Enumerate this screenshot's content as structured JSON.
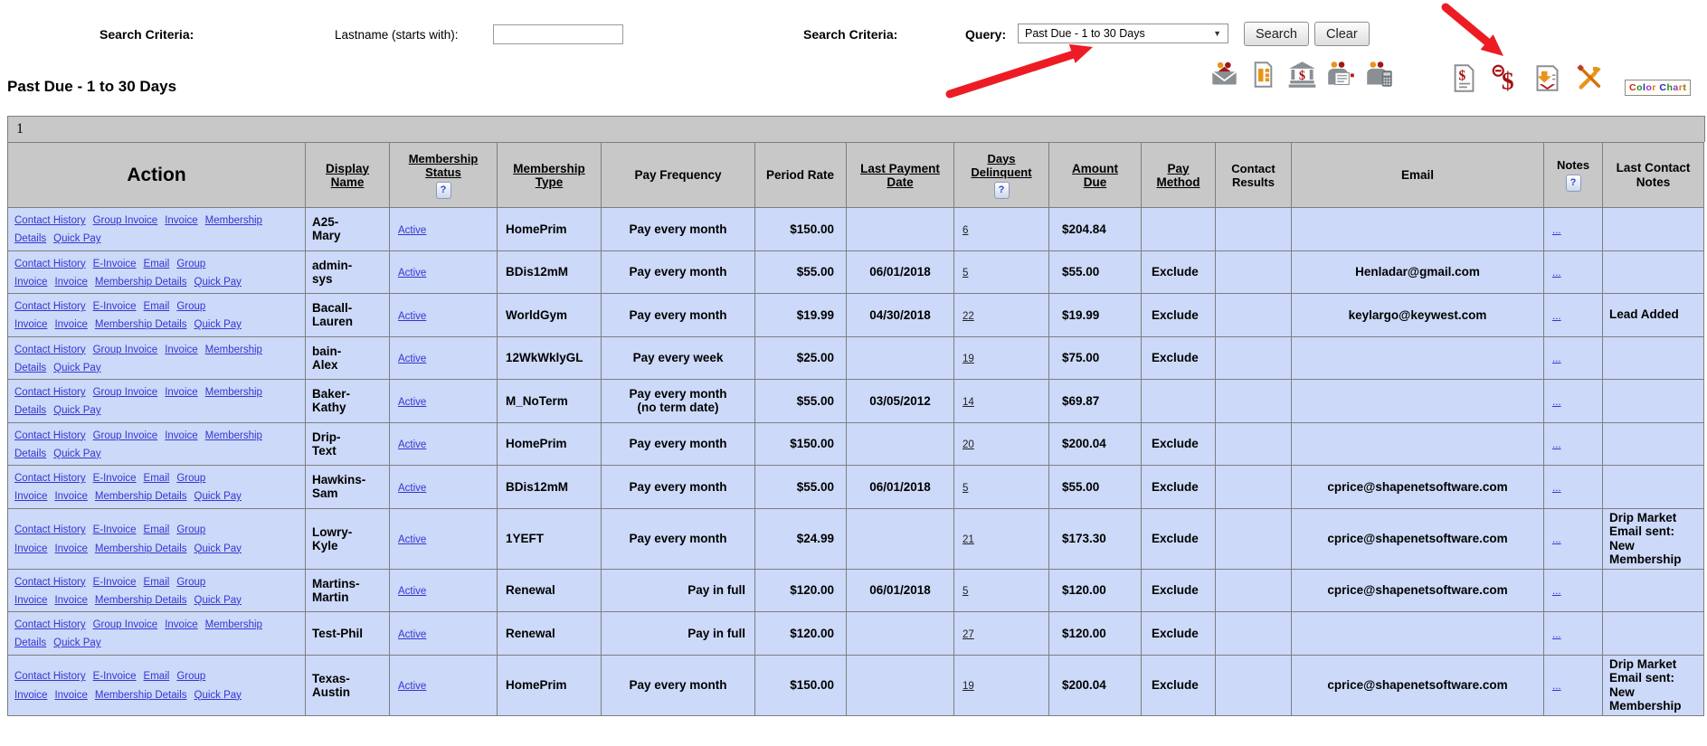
{
  "search_bar": {
    "criteria_label_left": "Search Criteria:",
    "lastname_label": "Lastname (starts with):",
    "lastname_value": "",
    "criteria_label_right": "Search Criteria:",
    "query_label": "Query:",
    "query_selected": "Past Due - 1 to 30 Days",
    "search_button": "Search",
    "clear_button": "Clear"
  },
  "page_title": "Past Due - 1 to 30 Days",
  "toolbar": {
    "icons_left": [
      "email-members-icon",
      "invoice-batch-icon",
      "bank-draft-icon",
      "contact-list-icon",
      "call-members-icon"
    ],
    "icons_right": [
      "statements-icon",
      "past-due-icon",
      "receive-payments-icon",
      "tools-icon"
    ],
    "color_chart_label": "Color Chart",
    "color_chart_letter_colors": [
      "#d42020",
      "#1f8c1f",
      "#2020d4",
      "#9932cc",
      "#e07820",
      "#777777",
      "#2020d4",
      "#1f8c1f",
      "#9932cc",
      "#e07820",
      "#8b6f14"
    ]
  },
  "pagination": {
    "page": "1"
  },
  "annotations": {
    "arrow_1_points_to": "query-dropdown",
    "arrow_2_points_to": "past-due-icon",
    "arrow_color": "#ed1c24"
  },
  "colors": {
    "row_bg": "#ccd9f8",
    "header_bg": "#c8c8c8",
    "link": "#3535d3"
  },
  "table": {
    "columns": [
      {
        "key": "action",
        "label": "Action",
        "sortable": false,
        "help": false
      },
      {
        "key": "display_name",
        "label": "Display Name",
        "sortable": true,
        "help": false
      },
      {
        "key": "membership_status",
        "label": "Membership Status",
        "sortable": true,
        "help": true
      },
      {
        "key": "membership_type",
        "label": "Membership Type",
        "sortable": true,
        "help": false
      },
      {
        "key": "pay_frequency",
        "label": "Pay Frequency",
        "sortable": false,
        "help": false
      },
      {
        "key": "period_rate",
        "label": "Period Rate",
        "sortable": false,
        "help": false
      },
      {
        "key": "last_payment_date",
        "label": "Last Payment Date",
        "sortable": true,
        "help": false
      },
      {
        "key": "days_delinquent",
        "label": "Days Delinquent",
        "sortable": true,
        "help": true
      },
      {
        "key": "amount_due",
        "label": "Amount Due",
        "sortable": true,
        "help": false
      },
      {
        "key": "pay_method",
        "label": "Pay Method",
        "sortable": true,
        "help": false
      },
      {
        "key": "contact_results",
        "label": "Contact Results",
        "sortable": false,
        "help": false
      },
      {
        "key": "email",
        "label": "Email",
        "sortable": false,
        "help": false
      },
      {
        "key": "notes",
        "label": "Notes",
        "sortable": false,
        "help": true
      },
      {
        "key": "last_contact_notes",
        "label": "Last Contact Notes",
        "sortable": false,
        "help": false
      }
    ],
    "rows": [
      {
        "action_links": [
          "Contact History",
          "Group Invoice",
          "Invoice",
          "Membership Details",
          "Quick Pay"
        ],
        "display_name": "A25-\nMary",
        "membership_status": "Active",
        "membership_type": "HomePrim",
        "pay_frequency": "Pay every month",
        "period_rate": "$150.00",
        "last_payment_date": "",
        "days_delinquent": "6",
        "amount_due": "$204.84",
        "pay_method": "",
        "contact_results": "",
        "email": "",
        "notes": "...",
        "last_contact_notes": ""
      },
      {
        "action_links": [
          "Contact History",
          "E-Invoice",
          "Email",
          "Group Invoice",
          "Invoice",
          "Membership Details",
          "Quick Pay"
        ],
        "display_name": "admin-\nsys",
        "membership_status": "Active",
        "membership_type": "BDis12mM",
        "pay_frequency": "Pay every month",
        "period_rate": "$55.00",
        "last_payment_date": "06/01/2018",
        "days_delinquent": "5",
        "amount_due": "$55.00",
        "pay_method": "Exclude",
        "contact_results": "",
        "email": "Henladar@gmail.com",
        "notes": "...",
        "last_contact_notes": ""
      },
      {
        "action_links": [
          "Contact History",
          "E-Invoice",
          "Email",
          "Group Invoice",
          "Invoice",
          "Membership Details",
          "Quick Pay"
        ],
        "display_name": "Bacall-\nLauren",
        "membership_status": "Active",
        "membership_type": "WorldGym",
        "pay_frequency": "Pay every month",
        "period_rate": "$19.99",
        "last_payment_date": "04/30/2018",
        "days_delinquent": "22",
        "amount_due": "$19.99",
        "pay_method": "Exclude",
        "contact_results": "",
        "email": "keylargo@keywest.com",
        "notes": "...",
        "last_contact_notes": "Lead Added"
      },
      {
        "action_links": [
          "Contact History",
          "Group Invoice",
          "Invoice",
          "Membership Details",
          "Quick Pay"
        ],
        "display_name": "bain-\nAlex",
        "membership_status": "Active",
        "membership_type": "12WkWklyGL",
        "pay_frequency": "Pay every week",
        "period_rate": "$25.00",
        "last_payment_date": "",
        "days_delinquent": "19",
        "amount_due": "$75.00",
        "pay_method": "Exclude",
        "contact_results": "",
        "email": "",
        "notes": "...",
        "last_contact_notes": ""
      },
      {
        "action_links": [
          "Contact History",
          "Group Invoice",
          "Invoice",
          "Membership Details",
          "Quick Pay"
        ],
        "display_name": "Baker-\nKathy",
        "membership_status": "Active",
        "membership_type": "M_NoTerm",
        "pay_frequency": "Pay every month\n(no term date)",
        "period_rate": "$55.00",
        "last_payment_date": "03/05/2012",
        "days_delinquent": "14",
        "amount_due": "$69.87",
        "pay_method": "",
        "contact_results": "",
        "email": "",
        "notes": "...",
        "last_contact_notes": ""
      },
      {
        "action_links": [
          "Contact History",
          "Group Invoice",
          "Invoice",
          "Membership Details",
          "Quick Pay"
        ],
        "display_name": "Drip-\nText",
        "membership_status": "Active",
        "membership_type": "HomePrim",
        "pay_frequency": "Pay every month",
        "period_rate": "$150.00",
        "last_payment_date": "",
        "days_delinquent": "20",
        "amount_due": "$200.04",
        "pay_method": "Exclude",
        "contact_results": "",
        "email": "",
        "notes": "...",
        "last_contact_notes": ""
      },
      {
        "action_links": [
          "Contact History",
          "E-Invoice",
          "Email",
          "Group Invoice",
          "Invoice",
          "Membership Details",
          "Quick Pay"
        ],
        "display_name": "Hawkins-\nSam",
        "membership_status": "Active",
        "membership_type": "BDis12mM",
        "pay_frequency": "Pay every month",
        "period_rate": "$55.00",
        "last_payment_date": "06/01/2018",
        "days_delinquent": "5",
        "amount_due": "$55.00",
        "pay_method": "Exclude",
        "contact_results": "",
        "email": "cprice@shapenetsoftware.com",
        "notes": "...",
        "last_contact_notes": ""
      },
      {
        "action_links": [
          "Contact History",
          "E-Invoice",
          "Email",
          "Group Invoice",
          "Invoice",
          "Membership Details",
          "Quick Pay"
        ],
        "display_name": "Lowry-\nKyle",
        "membership_status": "Active",
        "membership_type": "1YEFT",
        "pay_frequency": "Pay every month",
        "period_rate": "$24.99",
        "last_payment_date": "",
        "days_delinquent": "21",
        "amount_due": "$173.30",
        "pay_method": "Exclude",
        "contact_results": "",
        "email": "cprice@shapenetsoftware.com",
        "notes": "...",
        "last_contact_notes": "Drip Market Email sent: New Membership"
      },
      {
        "action_links": [
          "Contact History",
          "E-Invoice",
          "Email",
          "Group Invoice",
          "Invoice",
          "Membership Details",
          "Quick Pay"
        ],
        "display_name": "Martins-\nMartin",
        "membership_status": "Active",
        "membership_type": "Renewal",
        "pay_frequency": "Pay in full",
        "period_rate": "$120.00",
        "last_payment_date": "06/01/2018",
        "days_delinquent": "5",
        "amount_due": "$120.00",
        "pay_method": "Exclude",
        "contact_results": "",
        "email": "cprice@shapenetsoftware.com",
        "notes": "...",
        "last_contact_notes": ""
      },
      {
        "action_links": [
          "Contact History",
          "Group Invoice",
          "Invoice",
          "Membership Details",
          "Quick Pay"
        ],
        "display_name": "Test-Phil",
        "membership_status": "Active",
        "membership_type": "Renewal",
        "pay_frequency": "Pay in full",
        "period_rate": "$120.00",
        "last_payment_date": "",
        "days_delinquent": "27",
        "amount_due": "$120.00",
        "pay_method": "Exclude",
        "contact_results": "",
        "email": "",
        "notes": "...",
        "last_contact_notes": ""
      },
      {
        "action_links": [
          "Contact History",
          "E-Invoice",
          "Email",
          "Group Invoice",
          "Invoice",
          "Membership Details",
          "Quick Pay"
        ],
        "display_name": "Texas-\nAustin",
        "membership_status": "Active",
        "membership_type": "HomePrim",
        "pay_frequency": "Pay every month",
        "period_rate": "$150.00",
        "last_payment_date": "",
        "days_delinquent": "19",
        "amount_due": "$200.04",
        "pay_method": "Exclude",
        "contact_results": "",
        "email": "cprice@shapenetsoftware.com",
        "notes": "...",
        "last_contact_notes": "Drip Market Email sent: New Membership"
      }
    ]
  }
}
